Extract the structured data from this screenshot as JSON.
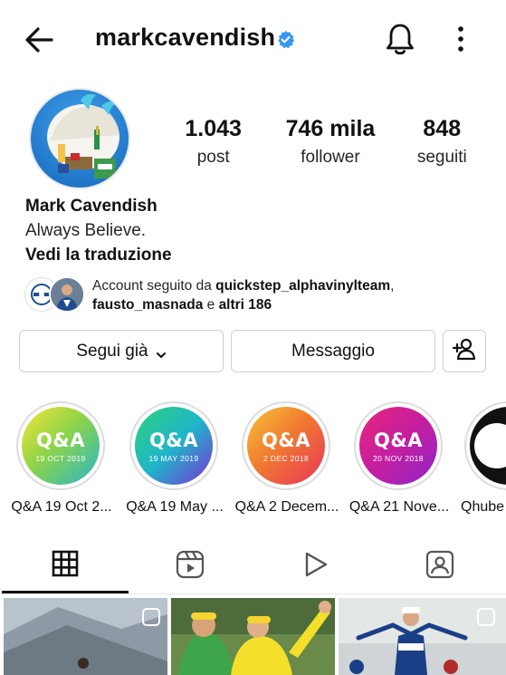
{
  "header": {
    "username": "markcavendish",
    "back_icon": "arrow-left-icon",
    "verified_icon": "verified-badge-icon",
    "bell_icon": "bell-icon",
    "more_icon": "more-vertical-icon"
  },
  "profile": {
    "stats": [
      {
        "value": "1.043",
        "label": "post"
      },
      {
        "value": "746 mila",
        "label": "follower"
      },
      {
        "value": "848",
        "label": "seguiti"
      }
    ],
    "name": "Mark Cavendish",
    "bio": "Always Believe.",
    "translate_label": "Vedi la traduzione",
    "followed_by": {
      "prefix": "Account seguito da ",
      "account1": "quickstep_alphavinylteam",
      "sep": ",",
      "account2": "fausto_masnada",
      "middle": " e ",
      "others": "altri 186"
    }
  },
  "actions": {
    "follow_label": "Segui già",
    "message_label": "Messaggio",
    "add_user_icon": "add-person-icon"
  },
  "highlights": [
    {
      "title": "Q&A",
      "date": "19 OCT 2019",
      "label": "Q&A 19 Oct 2..."
    },
    {
      "title": "Q&A",
      "date": "19 MAY 2019",
      "label": "Q&A 19 May ..."
    },
    {
      "title": "Q&A",
      "date": "2 DEC 2018",
      "label": "Q&A 2 Decem..."
    },
    {
      "title": "Q&A",
      "date": "20 NOV 2018",
      "label": "Q&A 21 Nove..."
    },
    {
      "title": "",
      "date": "",
      "label": "Qhube"
    }
  ],
  "tabs": [
    {
      "icon": "grid-icon",
      "active": true
    },
    {
      "icon": "reels-icon",
      "active": false
    },
    {
      "icon": "play-icon",
      "active": false
    },
    {
      "icon": "tagged-icon",
      "active": false
    }
  ],
  "colors": {
    "verified": "#3897f0",
    "text": "#262626",
    "border": "#cfcfcf"
  }
}
